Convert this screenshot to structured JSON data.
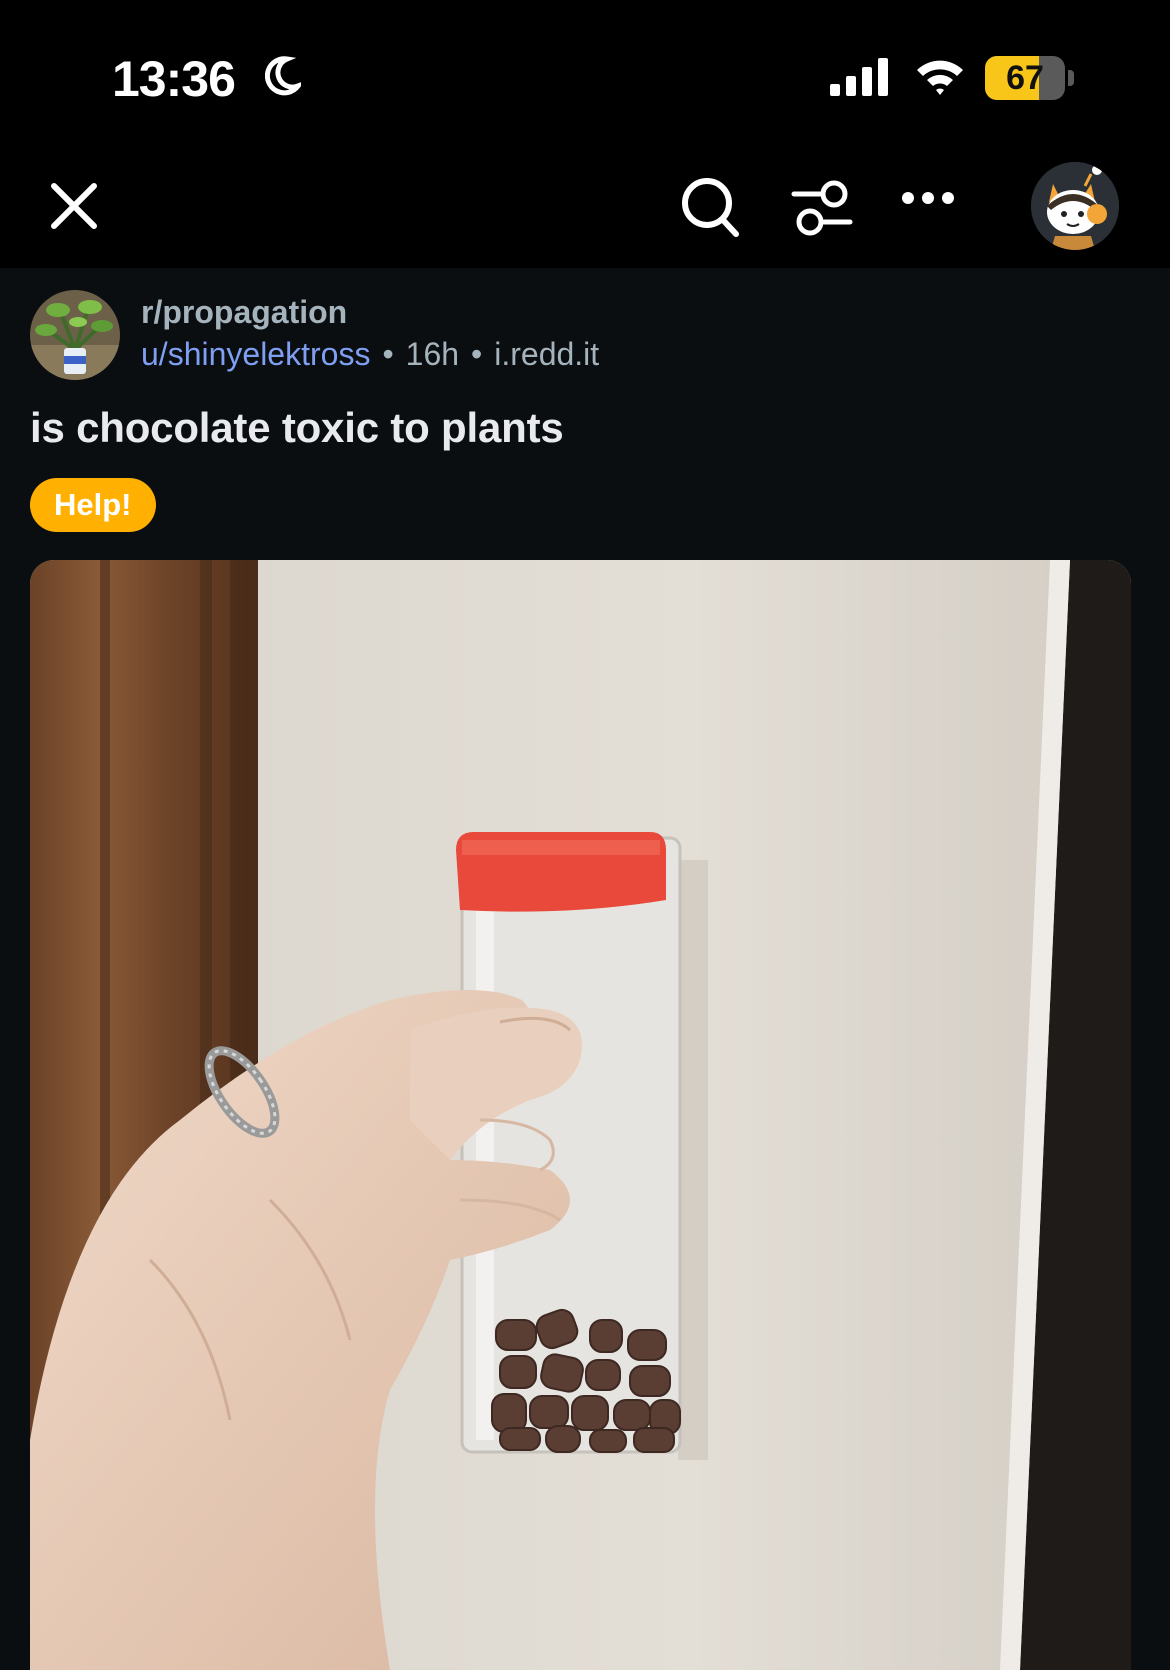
{
  "status_bar": {
    "time": "13:36",
    "battery_level": "67",
    "battery_percent": 67,
    "icons": [
      "moon-icon",
      "cellular-signal-icon",
      "wifi-icon",
      "battery-icon"
    ]
  },
  "nav": {
    "icons": [
      "close-icon",
      "search-icon",
      "filter-icon",
      "more-icon",
      "avatar"
    ]
  },
  "post": {
    "subreddit": "r/propagation",
    "username": "u/shinyelektross",
    "age": "16h",
    "domain": "i.redd.it",
    "separator": "•",
    "title": "is chocolate toxic to plants",
    "flair": "Help!"
  },
  "colors": {
    "flair_bg": "#ffb000",
    "username": "#7e9ff2",
    "battery_fill": "#f7c619",
    "background": "#0b0e11"
  }
}
